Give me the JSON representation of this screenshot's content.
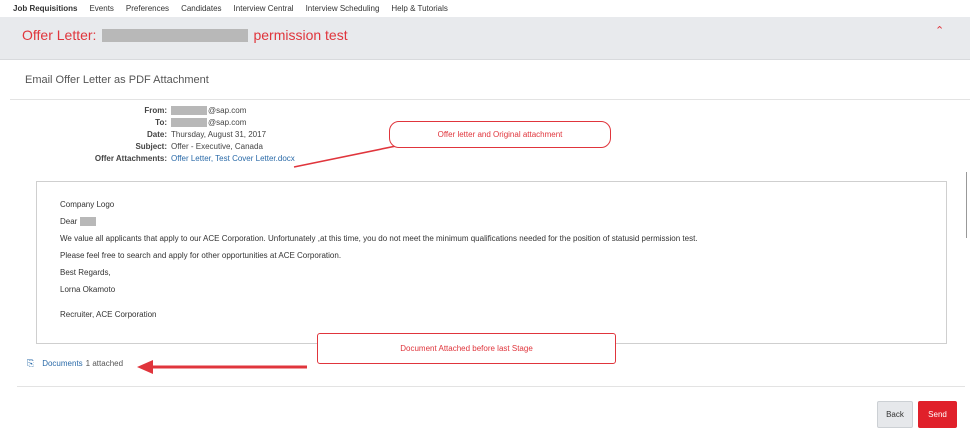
{
  "nav": {
    "items": [
      "Job Requisitions",
      "Events",
      "Preferences",
      "Candidates",
      "Interview Central",
      "Interview Scheduling",
      "Help & Tutorials"
    ]
  },
  "titlebar": {
    "prefix": "Offer Letter:",
    "suffix": "permission test"
  },
  "panel": {
    "title": "Email Offer Letter as PDF Attachment"
  },
  "meta": {
    "from_label": "From:",
    "from_value": "@sap.com",
    "to_label": "To:",
    "to_value": "@sap.com",
    "date_label": "Date:",
    "date_value": "Thursday, August 31, 2017",
    "subject_label": "Subject:",
    "subject_value": "Offer - Executive, Canada",
    "attach_label": "Offer Attachments:",
    "attach_value": "Offer Letter, Test Cover Letter.docx"
  },
  "email_body": {
    "logo": "Company Logo",
    "greeting": "Dear",
    "line1": "We value all applicants that apply to our ACE Corporation.  Unfortunately ,at this time, you do not meet the minimum qualifications needed for the position of statusid permission test.",
    "line2": "Please feel free to search and apply for other opportunities at ACE Corporation.",
    "regards": "Best Regards,",
    "signer": "Lorna Okamoto",
    "signer_title": "Recruiter, ACE Corporation"
  },
  "documents": {
    "label": "Documents",
    "count": "1 attached"
  },
  "buttons": {
    "back": "Back",
    "send": "Send"
  },
  "annotations": {
    "note1": "Offer letter and Original attachment",
    "note2": "Document Attached before last Stage"
  },
  "colors": {
    "accent_red": "#e0353c",
    "link_blue": "#2a6aa8"
  }
}
